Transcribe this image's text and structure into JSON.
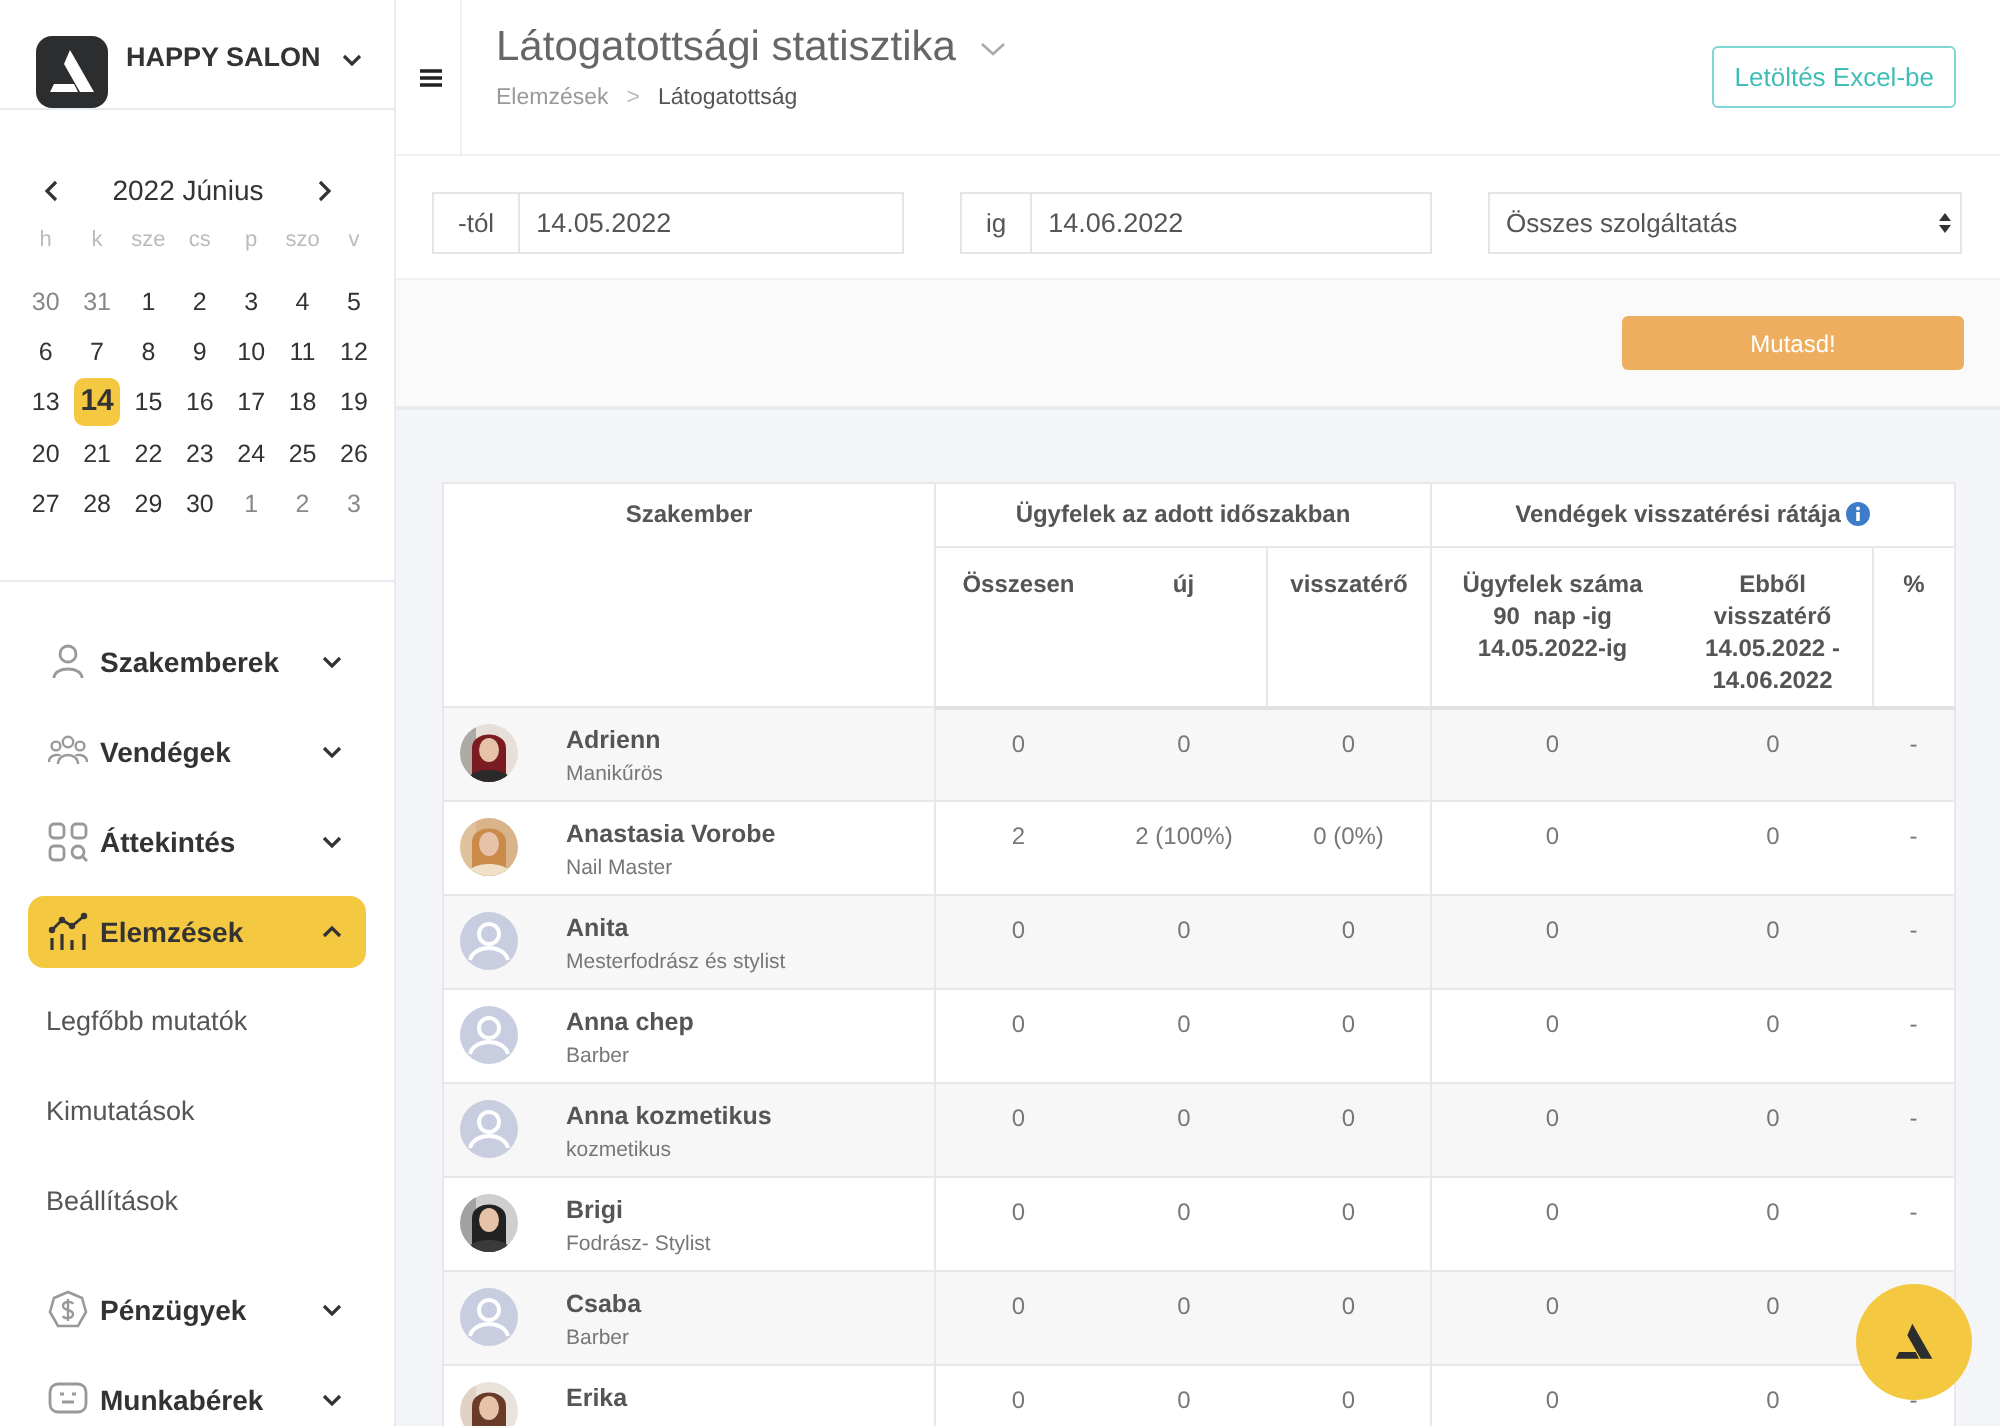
{
  "brand": {
    "name": "HAPPY SALON"
  },
  "calendar": {
    "title": "2022 Június",
    "weekdays": [
      "h",
      "k",
      "sze",
      "cs",
      "p",
      "szo",
      "v"
    ],
    "days": [
      {
        "label": "30",
        "muted": true,
        "selected": false
      },
      {
        "label": "31",
        "muted": true,
        "selected": false
      },
      {
        "label": "1",
        "muted": false,
        "selected": false
      },
      {
        "label": "2",
        "muted": false,
        "selected": false
      },
      {
        "label": "3",
        "muted": false,
        "selected": false
      },
      {
        "label": "4",
        "muted": false,
        "selected": false
      },
      {
        "label": "5",
        "muted": false,
        "selected": false
      },
      {
        "label": "6",
        "muted": false,
        "selected": false
      },
      {
        "label": "7",
        "muted": false,
        "selected": false
      },
      {
        "label": "8",
        "muted": false,
        "selected": false
      },
      {
        "label": "9",
        "muted": false,
        "selected": false
      },
      {
        "label": "10",
        "muted": false,
        "selected": false
      },
      {
        "label": "11",
        "muted": false,
        "selected": false
      },
      {
        "label": "12",
        "muted": false,
        "selected": false
      },
      {
        "label": "13",
        "muted": false,
        "selected": false
      },
      {
        "label": "14",
        "muted": false,
        "selected": true
      },
      {
        "label": "15",
        "muted": false,
        "selected": false
      },
      {
        "label": "16",
        "muted": false,
        "selected": false
      },
      {
        "label": "17",
        "muted": false,
        "selected": false
      },
      {
        "label": "18",
        "muted": false,
        "selected": false
      },
      {
        "label": "19",
        "muted": false,
        "selected": false
      },
      {
        "label": "20",
        "muted": false,
        "selected": false
      },
      {
        "label": "21",
        "muted": false,
        "selected": false
      },
      {
        "label": "22",
        "muted": false,
        "selected": false
      },
      {
        "label": "23",
        "muted": false,
        "selected": false
      },
      {
        "label": "24",
        "muted": false,
        "selected": false
      },
      {
        "label": "25",
        "muted": false,
        "selected": false
      },
      {
        "label": "26",
        "muted": false,
        "selected": false
      },
      {
        "label": "27",
        "muted": false,
        "selected": false
      },
      {
        "label": "28",
        "muted": false,
        "selected": false
      },
      {
        "label": "29",
        "muted": false,
        "selected": false
      },
      {
        "label": "30",
        "muted": false,
        "selected": false
      },
      {
        "label": "1",
        "muted": true,
        "selected": false
      },
      {
        "label": "2",
        "muted": true,
        "selected": false
      },
      {
        "label": "3",
        "muted": true,
        "selected": false
      }
    ]
  },
  "nav": [
    {
      "kind": "group",
      "label": "Szakemberek",
      "expanded": false,
      "selected": false
    },
    {
      "kind": "group",
      "label": "Vendégek",
      "expanded": false,
      "selected": false
    },
    {
      "kind": "group",
      "label": "Áttekintés",
      "expanded": false,
      "selected": false
    },
    {
      "kind": "group",
      "label": "Elemzések",
      "expanded": true,
      "selected": true
    },
    {
      "kind": "subitem",
      "label": "Legfőbb mutatók"
    },
    {
      "kind": "subitem",
      "label": "Kimutatások"
    },
    {
      "kind": "subitem",
      "label": "Beállítások"
    },
    {
      "kind": "group",
      "label": "Pénzügyek",
      "expanded": false,
      "selected": false
    },
    {
      "kind": "group",
      "label": "Munkabérek",
      "expanded": false,
      "selected": false
    }
  ],
  "header": {
    "title": "Látogatottsági statisztika",
    "breadcrumbs": [
      "Elemzések",
      ">",
      "Látogatottság"
    ],
    "export_button": "Letöltés Excel-be"
  },
  "filters": {
    "from": {
      "addon": "-tól",
      "value": "14.05.2022"
    },
    "to": {
      "addon": "ig",
      "value": "14.06.2022"
    },
    "service": {
      "value": "Összes szolgáltatás"
    },
    "submit": "Mutasd!"
  },
  "table": {
    "groups": [
      "Szakember",
      "Ügyfelek az adott időszakban",
      "Vendégek visszatérési rátája"
    ],
    "columns": [
      "Összesen",
      "új",
      "visszatérő",
      "Ügyfelek száma\n90  nap -ig\n14.05.2022-ig",
      "Ebből\nvisszatérő\n14.05.2022 -\n14.06.2022",
      "%"
    ],
    "rows": [
      {
        "name": "Adrienn",
        "role": "Manikűrös",
        "values": [
          "0",
          "0",
          "0",
          "0",
          "0",
          "-"
        ]
      },
      {
        "name": "Anastasia Vorobe",
        "role": "Nail Master",
        "values": [
          "2",
          "2 (100%)",
          "0 (0%)",
          "0",
          "0",
          "-"
        ]
      },
      {
        "kind": "placeholder",
        "name": "Anita",
        "role": "Mesterfodrász és stylist",
        "values": [
          "0",
          "0",
          "0",
          "0",
          "0",
          "-"
        ]
      },
      {
        "kind": "placeholder",
        "name": "Anna chep",
        "role": "Barber",
        "values": [
          "0",
          "0",
          "0",
          "0",
          "0",
          "-"
        ]
      },
      {
        "kind": "placeholder",
        "name": "Anna kozmetikus",
        "role": "kozmetikus",
        "values": [
          "0",
          "0",
          "0",
          "0",
          "0",
          "-"
        ]
      },
      {
        "name": "Brigi",
        "role": "Fodrász- Stylist",
        "values": [
          "0",
          "0",
          "0",
          "0",
          "0",
          "-"
        ]
      },
      {
        "kind": "placeholder",
        "name": "Csaba",
        "role": "Barber",
        "values": [
          "0",
          "0",
          "0",
          "0",
          "0"
        ]
      },
      {
        "name": "Erika",
        "values": [
          "0",
          "0",
          "0",
          "0",
          "0",
          "-"
        ]
      }
    ]
  }
}
